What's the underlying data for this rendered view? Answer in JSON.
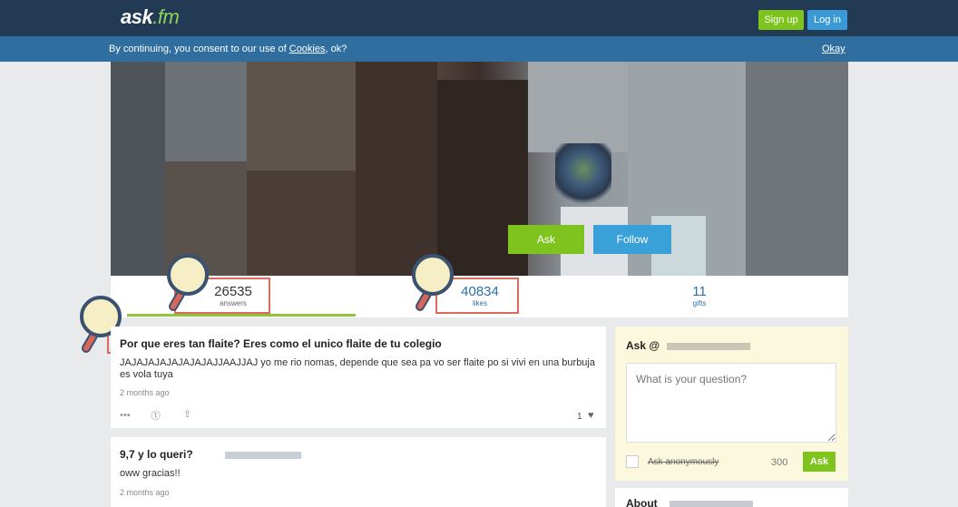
{
  "header": {
    "logo_main": "ask",
    "logo_suffix": ".fm",
    "signup_label": "Sign up",
    "login_label": "Log in"
  },
  "cookie": {
    "text_before": "By continuing, you consent to our use of ",
    "link_label": "Cookies",
    "text_after": ", ok?",
    "okay_label": "Okay"
  },
  "profile": {
    "ask_label": "Ask",
    "follow_label": "Follow"
  },
  "stats": [
    {
      "value": "26535",
      "label": "answers"
    },
    {
      "value": "40834",
      "label": "likes"
    },
    {
      "value": "11",
      "label": "gifts"
    }
  ],
  "feed": [
    {
      "question": "Por que eres tan flaite? Eres como el unico flaite de tu colegio",
      "answer": "JAJAJAJAJAJAJAJAJJAAJJAJ yo me rio nomas, depende que sea pa vo ser flaite po si vivi en una burbuja es vola tuya",
      "time": "2 months ago",
      "likes": "1"
    },
    {
      "question": "9,7 y lo queri?",
      "answer": "oww gracias!!",
      "time": "2 months ago"
    }
  ],
  "ask_box": {
    "title": "Ask @",
    "placeholder": "What is your question?",
    "anonymous_label": "Ask anonymously",
    "char_count": "300",
    "button_label": "Ask"
  },
  "about": {
    "title": "About"
  },
  "colors": {
    "topbar": "#233a55",
    "cookiebar": "#2f6e9e",
    "green": "#7fc41e",
    "blue": "#3a9ad6",
    "highlight": "#d96a5e"
  }
}
